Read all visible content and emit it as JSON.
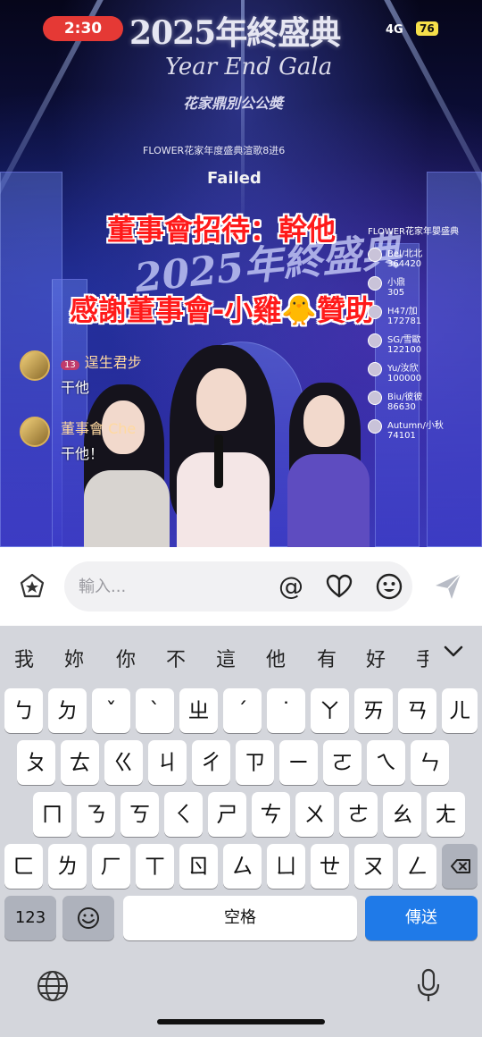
{
  "status_bar": {
    "time": "2:30",
    "network": "4G",
    "battery": "76"
  },
  "stream": {
    "title": "2025年終盛典",
    "subtitle": "Year End Gala",
    "org": "花家鼎別公公奬",
    "caption": "FLOWER花家年度盛典渲歌8进6",
    "error": "Failed",
    "stage_logo": "2025年終盛典",
    "overlay_lines": [
      "董事會招待：幹他",
      "感謝董事會-小雞🐥贊助"
    ],
    "ranking": {
      "title": "FLOWER花家年嬰盛典",
      "rows": [
        {
          "name": "Bel/北北",
          "score": "364420"
        },
        {
          "name": "小鼎",
          "score": "305"
        },
        {
          "name": "H47/加",
          "score": "172781"
        },
        {
          "name": "SG/雪歐",
          "score": "122100"
        },
        {
          "name": "Yu/汝欣",
          "score": "100000"
        },
        {
          "name": "Biu/彼彼",
          "score": "86630"
        },
        {
          "name": "Autumn/小秋",
          "score": "74101"
        }
      ]
    },
    "chat": [
      {
        "level": "13",
        "user": "逞生君步",
        "message": "干他"
      },
      {
        "level": "",
        "user": "董事會 Che",
        "message": "干他！"
      }
    ]
  },
  "input_bar": {
    "placeholder": "輸入..."
  },
  "keyboard": {
    "suggestions": [
      "我",
      "妳",
      "你",
      "不",
      "這",
      "他",
      "有",
      "好",
      "手"
    ],
    "row1": [
      "ㄅ",
      "ㄉ",
      "ˇ",
      "ˋ",
      "ㄓ",
      "ˊ",
      "˙",
      "ㄚ",
      "ㄞ",
      "ㄢ",
      "ㄦ"
    ],
    "row2": [
      "ㄆ",
      "ㄊ",
      "ㄍ",
      "ㄐ",
      "ㄔ",
      "ㄗ",
      "ㄧ",
      "ㄛ",
      "ㄟ",
      "ㄣ"
    ],
    "row3": [
      "ㄇ",
      "ㄋ",
      "ㄎ",
      "ㄑ",
      "ㄕ",
      "ㄘ",
      "ㄨ",
      "ㄜ",
      "ㄠ",
      "ㄤ"
    ],
    "row4": [
      "ㄈ",
      "ㄌ",
      "ㄏ",
      "ㄒ",
      "ㄖ",
      "ㄙ",
      "ㄩ",
      "ㄝ",
      "ㄡ",
      "ㄥ"
    ],
    "numbers_label": "123",
    "space_label": "空格",
    "return_label": "傳送"
  },
  "colors": {
    "accent": "#1f7ae8",
    "time_pill": "#e53935",
    "overlay_text": "#ff1a1a"
  }
}
